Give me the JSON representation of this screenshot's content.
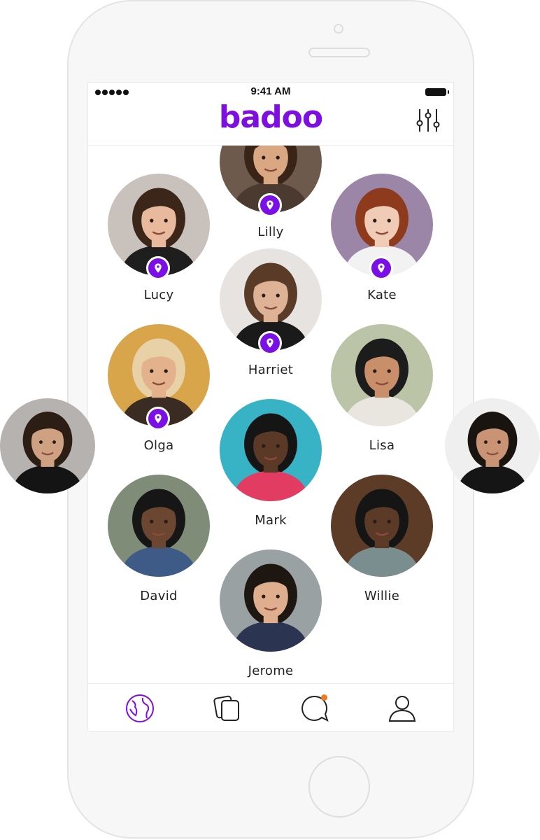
{
  "status_bar": {
    "time": "9:41 AM"
  },
  "app": {
    "logo": "badoo",
    "brand_color": "#7f0fe0",
    "filter_icon": "sliders-icon",
    "pin_icon": "location-pin-icon"
  },
  "people": [
    {
      "name": "Lilly",
      "has_pin": true,
      "bg": "#6e5a4c",
      "skin": "#d9a883",
      "hair": "#3a2418",
      "top": "#4a3a30"
    },
    {
      "name": "Lucy",
      "has_pin": true,
      "bg": "#c9c2bc",
      "skin": "#e8b99c",
      "hair": "#3b2619",
      "top": "#1e1e1e"
    },
    {
      "name": "Kate",
      "has_pin": true,
      "bg": "#9b86a8",
      "skin": "#f0ccb6",
      "hair": "#8e3a1c",
      "top": "#f2f2f2"
    },
    {
      "name": "Harriet",
      "has_pin": true,
      "bg": "#e6e3e1",
      "skin": "#deb294",
      "hair": "#5a3b27",
      "top": "#1a1a1a"
    },
    {
      "name": "Olga",
      "has_pin": true,
      "bg": "#d9a54a",
      "skin": "#e4b18d",
      "hair": "#e8d1a6",
      "top": "#3a2c22"
    },
    {
      "name": "Lisa",
      "has_pin": false,
      "bg": "#bcc4a8",
      "skin": "#c98f6a",
      "hair": "#1c1c1c",
      "top": "#e9e5df"
    },
    {
      "name": "Mark",
      "has_pin": false,
      "bg": "#38b3c6",
      "skin": "#5a3a26",
      "hair": "#151515",
      "top": "#e23c63"
    },
    {
      "name": "David",
      "has_pin": false,
      "bg": "#7e8c78",
      "skin": "#6b4630",
      "hair": "#161616",
      "top": "#3e5a86"
    },
    {
      "name": "Willie",
      "has_pin": false,
      "bg": "#5c3b27",
      "skin": "#5b3b28",
      "hair": "#151515",
      "top": "#7b8e8f"
    },
    {
      "name": "Jerome",
      "has_pin": false,
      "bg": "#9aa1a3",
      "skin": "#dfae8e",
      "hair": "#1d1611",
      "top": "#2b3552"
    }
  ],
  "side_photos": [
    {
      "label": "left-profile-photo",
      "bg": "#b5b2af",
      "skin": "#cfa183",
      "hair": "#2d1e15",
      "top": "#141414"
    },
    {
      "label": "right-profile-photo",
      "bg": "#efefef",
      "skin": "#c99476",
      "hair": "#1a1411",
      "top": "#151515"
    }
  ],
  "tabs": [
    {
      "name": "globe",
      "icon": "globe-icon",
      "active": true
    },
    {
      "name": "cards",
      "icon": "cards-icon",
      "active": false
    },
    {
      "name": "chat",
      "icon": "chat-bubble-icon",
      "active": false,
      "has_badge": true,
      "badge_color": "#f07a1c"
    },
    {
      "name": "profile",
      "icon": "profile-icon",
      "active": false
    }
  ]
}
